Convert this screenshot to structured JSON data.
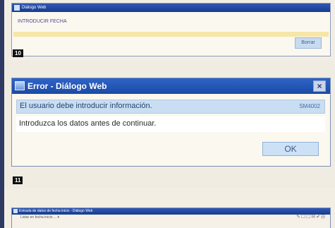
{
  "panel1": {
    "title": "Diálogo Web",
    "message": "INTRODUCIR FECHA",
    "button_label": "Borrar",
    "step_number": "10"
  },
  "panel2": {
    "title": "Error - Diálogo Web",
    "close_symbol": "×",
    "message_line1": "El usuario debe introducir información.",
    "message_code": "SM4002",
    "message_line2": "Introduzca los datos antes de continuar.",
    "ok_label": "OK",
    "step_number": "11"
  },
  "panel3": {
    "title": "Entrada de datos de fecha inicio - Diálogo Web",
    "menu_text": "Listar en fecha inicio ... ▾",
    "toolbar_icons": "✎☐☐✉✔⊟"
  }
}
